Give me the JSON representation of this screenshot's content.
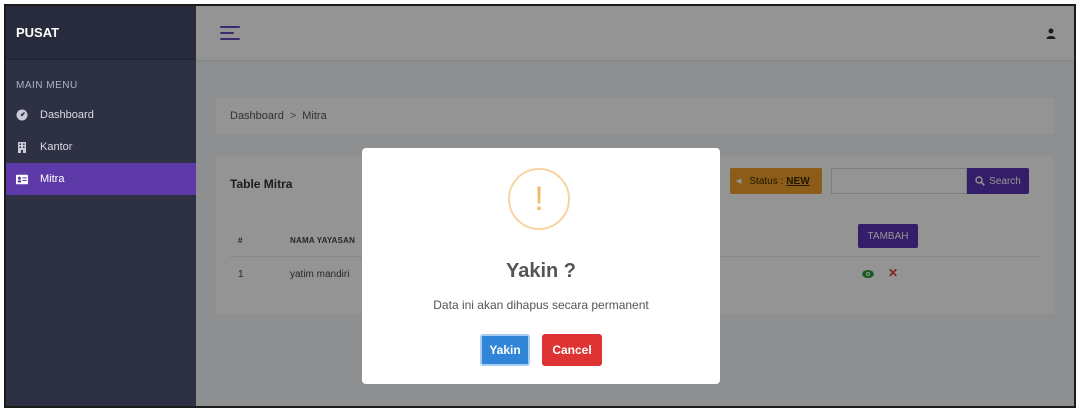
{
  "brand": "PUSAT",
  "sidebar": {
    "header": "MAIN MENU",
    "items": [
      {
        "label": "Dashboard",
        "icon": "dashboard-icon"
      },
      {
        "label": "Kantor",
        "icon": "building-icon"
      },
      {
        "label": "Mitra",
        "icon": "id-card-icon",
        "active": true
      }
    ]
  },
  "breadcrumb": {
    "root": "Dashboard",
    "separator": ">",
    "current": "Mitra"
  },
  "card": {
    "title": "Table Mitra",
    "status_label": "Status :",
    "status_value": "NEW",
    "search_placeholder": "",
    "search_button": "Search",
    "add_button": "TAMBAH",
    "columns": [
      "#",
      "NAMA YAYASAN"
    ],
    "rows": [
      {
        "no": "1",
        "nama": "yatim mandiri"
      }
    ]
  },
  "modal": {
    "icon_glyph": "!",
    "title": "Yakin ?",
    "text": "Data ini akan dihapus secara permanent",
    "confirm": "Yakin",
    "cancel": "Cancel"
  },
  "colors": {
    "sidebar": "#2d3143",
    "accent": "#5b32b5",
    "status": "#f0a02a",
    "confirm": "#3085d6",
    "cancel": "#dd3333",
    "warning": "#f8bb86"
  }
}
